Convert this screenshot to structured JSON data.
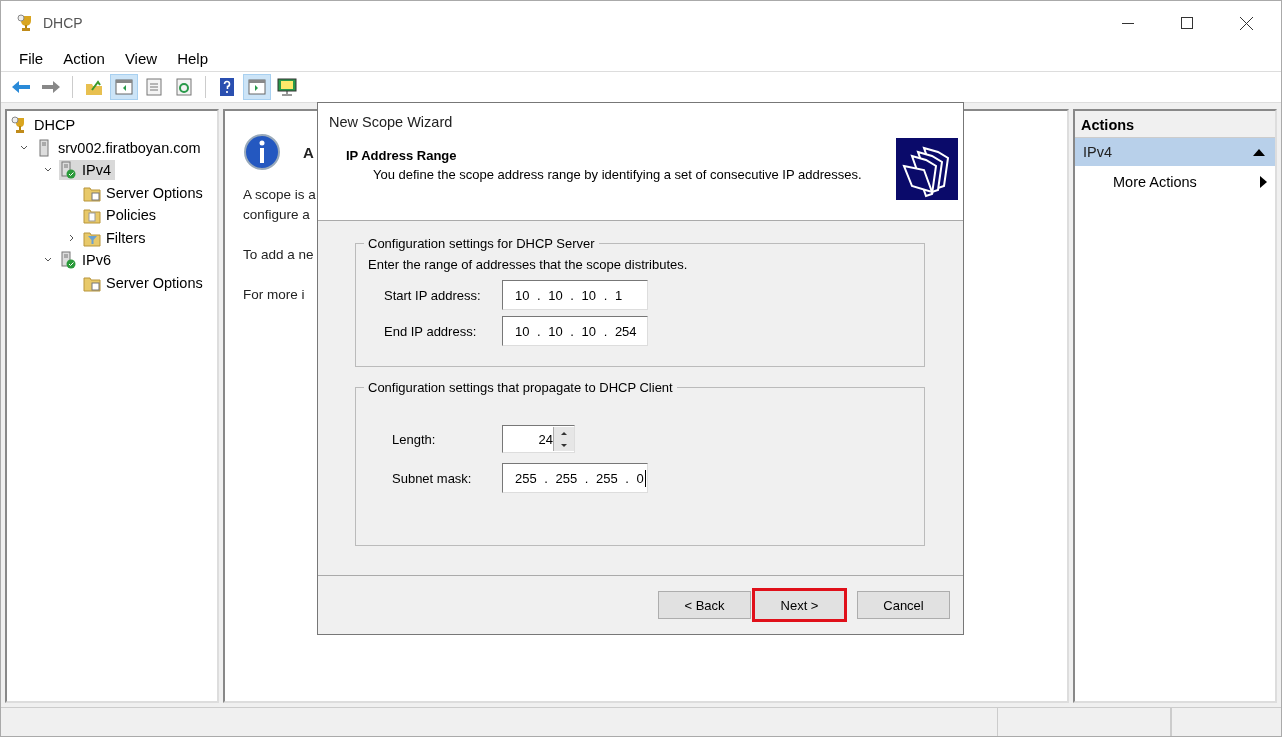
{
  "window": {
    "title": "DHCP"
  },
  "menu": [
    "File",
    "Action",
    "View",
    "Help"
  ],
  "toolbar": [
    {
      "kind": "back",
      "pressed": false
    },
    {
      "kind": "forward",
      "pressed": false
    },
    {
      "kind": "up",
      "pressed": false
    },
    {
      "kind": "tree-pane",
      "pressed": true
    },
    {
      "kind": "properties",
      "pressed": false
    },
    {
      "kind": "refresh",
      "pressed": false
    },
    {
      "kind": "help",
      "pressed": false
    },
    {
      "kind": "action-pane",
      "pressed": true
    },
    {
      "kind": "monitor",
      "pressed": false
    }
  ],
  "tree": [
    {
      "label": "DHCP",
      "kind": "dhcp",
      "selected": false,
      "children": [
        {
          "label": "srv002.firatboyan.com",
          "kind": "server",
          "selected": false,
          "expanded": true,
          "children": [
            {
              "label": "IPv4",
              "kind": "protocol",
              "selected": true,
              "expanded": true,
              "children": [
                {
                  "label": "Server Options",
                  "kind": "options",
                  "selected": false
                },
                {
                  "label": "Policies",
                  "kind": "policies",
                  "selected": false
                },
                {
                  "label": "Filters",
                  "kind": "filters",
                  "selected": false,
                  "expanded": false
                }
              ]
            },
            {
              "label": "IPv6",
              "kind": "protocol",
              "selected": false,
              "expanded": true,
              "children": [
                {
                  "label": "Server Options",
                  "kind": "options",
                  "selected": false
                }
              ]
            }
          ]
        }
      ]
    }
  ],
  "content": {
    "heading": "A",
    "paragraphs": [
      [
        "A scope is a",
        "configure a"
      ],
      [
        "To add a ne"
      ],
      [
        "For more i"
      ]
    ]
  },
  "actions": {
    "title": "Actions",
    "sections": [
      {
        "label": "IPv4",
        "expanded": true,
        "items": [
          {
            "label": "More Actions"
          }
        ]
      }
    ]
  },
  "wizard": {
    "title": "New Scope Wizard",
    "heading": "IP Address Range",
    "subtitle": "You define the scope address range by identifying a set of consecutive IP addresses.",
    "server_group": {
      "legend": "Configuration settings for DHCP Server",
      "description": "Enter the range of addresses that the scope distributes.",
      "fields": [
        {
          "label": "Start IP address:",
          "value": "10 . 10 . 10 . 1"
        },
        {
          "label": "End IP address:",
          "value": "10 . 10 . 10 . 254"
        }
      ]
    },
    "client_group": {
      "legend": "Configuration settings that propagate to DHCP Client",
      "length": {
        "label": "Length:",
        "value": "24"
      },
      "subnet_mask": {
        "label": "Subnet mask:",
        "value": "255 . 255 . 255 . 0",
        "focused": true
      }
    },
    "buttons": [
      {
        "label": "< Back",
        "highlighted": false
      },
      {
        "label": "Next >",
        "highlighted": true
      },
      {
        "label": "Cancel",
        "highlighted": false
      }
    ]
  }
}
